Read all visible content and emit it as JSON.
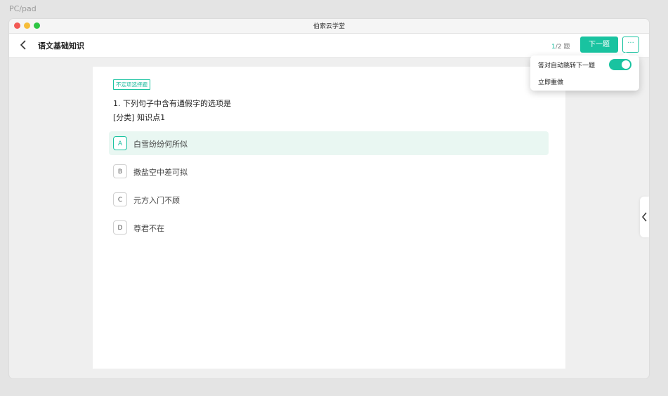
{
  "frame_label": "PC/pad",
  "window": {
    "title": "伯索云学堂"
  },
  "header": {
    "title": "语文基础知识",
    "progress_current": "1",
    "progress_rest": "/2 题",
    "next_label": "下一题",
    "more_label": "···"
  },
  "question": {
    "type_tag": "不定项选择题",
    "text": "1. 下列句子中含有通假字的选项是",
    "category": "[分类] 知识点1",
    "options": [
      {
        "letter": "A",
        "text": "白雪纷纷何所似",
        "selected": true
      },
      {
        "letter": "B",
        "text": "撒盐空中差可拟",
        "selected": false
      },
      {
        "letter": "C",
        "text": "元方入门不顾",
        "selected": false
      },
      {
        "letter": "D",
        "text": "尊君不在",
        "selected": false
      }
    ]
  },
  "menu": {
    "auto_next_label": "答对自动跳转下一题",
    "auto_next_enabled": true,
    "redo_label": "立即重做"
  },
  "icons": {
    "back": "chevron-left-icon",
    "side_tab": "chevron-left-icon",
    "more": "ellipsis-icon"
  },
  "colors": {
    "accent": "#19c3a0",
    "selected_bg": "#e9f7f2",
    "close": "#f25a55",
    "minimize": "#f6bd3a",
    "maximize": "#2dc543"
  }
}
